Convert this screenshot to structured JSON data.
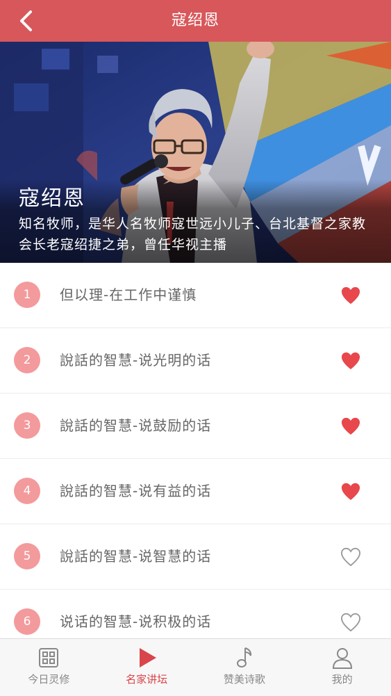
{
  "nav": {
    "title": "寇绍恩"
  },
  "hero": {
    "name": "寇绍恩",
    "description": "知名牧师，是华人名牧师寇世远小儿子、台北基督之家教会长老寇绍捷之弟，曾任华视主播"
  },
  "list": [
    {
      "number": "1",
      "title": "但以理-在工作中谨慎",
      "favorited": true
    },
    {
      "number": "2",
      "title": "說話的智慧-说光明的话",
      "favorited": true
    },
    {
      "number": "3",
      "title": "說話的智慧-说鼓励的话",
      "favorited": true
    },
    {
      "number": "4",
      "title": "說話的智慧-说有益的话",
      "favorited": true
    },
    {
      "number": "5",
      "title": "說話的智慧-说智慧的话",
      "favorited": false
    },
    {
      "number": "6",
      "title": "说话的智慧-说积极的话",
      "favorited": false
    }
  ],
  "tabs": [
    {
      "label": "今日灵修",
      "icon": "grid-icon",
      "active": false
    },
    {
      "label": "名家讲坛",
      "icon": "play-icon",
      "active": true
    },
    {
      "label": "赞美诗歌",
      "icon": "music-note-icon",
      "active": false
    },
    {
      "label": "我的",
      "icon": "user-icon",
      "active": false
    }
  ],
  "colors": {
    "nav_background": "#d8575a",
    "number_badge": "#f39a9c",
    "favorite_filled": "#e8474b",
    "favorite_outline": "#999999",
    "tab_active": "#d8454a",
    "tab_inactive": "#888888"
  }
}
